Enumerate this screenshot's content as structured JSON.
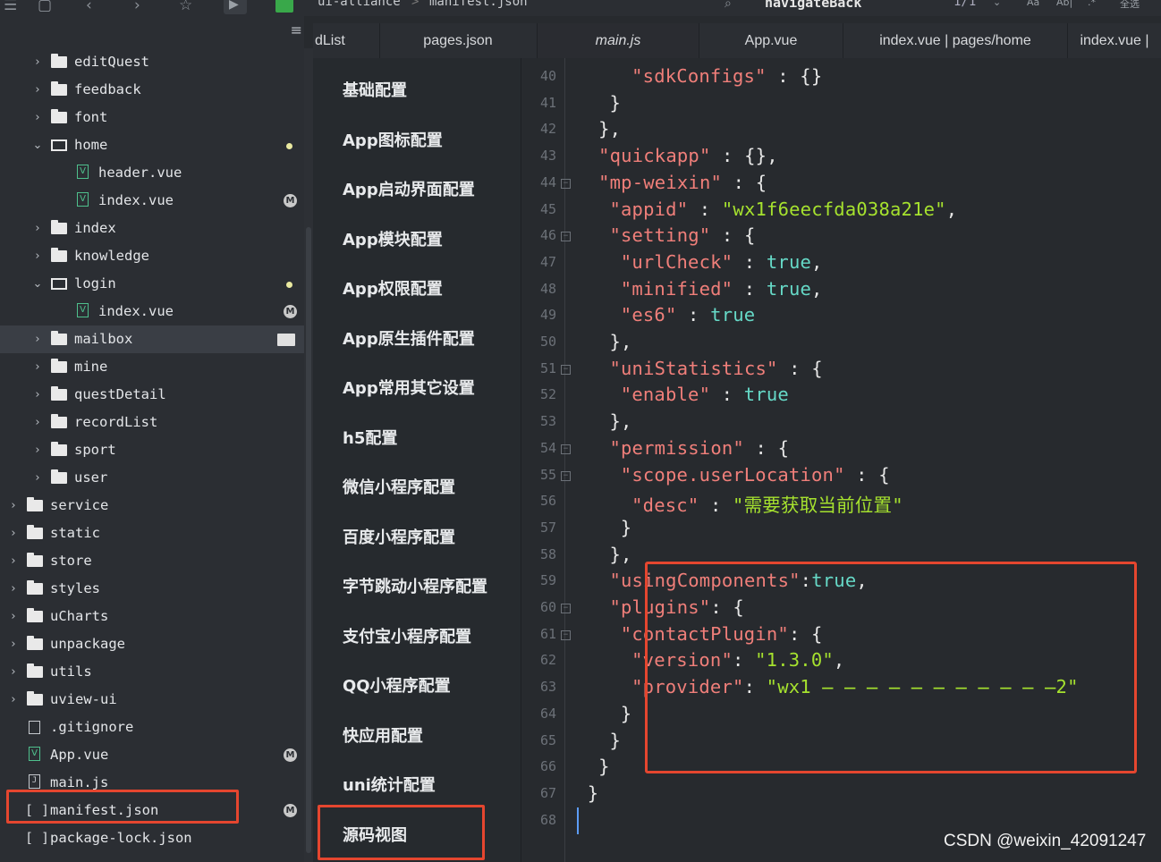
{
  "toolbar": {
    "breadcrumb_project": "ui-alliance",
    "breadcrumb_sep": ">",
    "breadcrumb_file": "manifest.json",
    "search_text": "navigateBack",
    "match_count": "1/1",
    "opt_case": "Aa",
    "opt_word": "Ab|",
    "opt_regex": ".*",
    "opt_select_all": "全选"
  },
  "sidebar": {
    "items": [
      {
        "label": "editQuest"
      },
      {
        "label": "feedback"
      },
      {
        "label": "font"
      },
      {
        "label": "home"
      },
      {
        "label": "header.vue"
      },
      {
        "label": "index.vue",
        "badge": "M"
      },
      {
        "label": "index"
      },
      {
        "label": "knowledge"
      },
      {
        "label": "login"
      },
      {
        "label": "index.vue",
        "badge": "M"
      },
      {
        "label": "mailbox"
      },
      {
        "label": "mine"
      },
      {
        "label": "questDetail"
      },
      {
        "label": "recordList"
      },
      {
        "label": "sport"
      },
      {
        "label": "user"
      },
      {
        "label": "service"
      },
      {
        "label": "static"
      },
      {
        "label": "store"
      },
      {
        "label": "styles"
      },
      {
        "label": "uCharts"
      },
      {
        "label": "unpackage"
      },
      {
        "label": "utils"
      },
      {
        "label": "uview-ui"
      },
      {
        "label": ".gitignore"
      },
      {
        "label": "App.vue",
        "badge": "M"
      },
      {
        "label": "main.js"
      },
      {
        "label": "manifest.json",
        "badge": "M"
      },
      {
        "label": "package-lock.json"
      }
    ]
  },
  "tabs": [
    {
      "label": "dList"
    },
    {
      "label": "pages.json"
    },
    {
      "label": "main.js"
    },
    {
      "label": "App.vue"
    },
    {
      "label": "index.vue | pages/home"
    },
    {
      "label": "index.vue |"
    }
  ],
  "categories": [
    {
      "label": "基础配置"
    },
    {
      "label": "App图标配置"
    },
    {
      "label": "App启动界面配置"
    },
    {
      "label": "App模块配置"
    },
    {
      "label": "App权限配置"
    },
    {
      "label": "App原生插件配置"
    },
    {
      "label": "App常用其它设置"
    },
    {
      "label": "h5配置"
    },
    {
      "label": "微信小程序配置"
    },
    {
      "label": "百度小程序配置"
    },
    {
      "label": "字节跳动小程序配置"
    },
    {
      "label": "支付宝小程序配置"
    },
    {
      "label": "QQ小程序配置"
    },
    {
      "label": "快应用配置"
    },
    {
      "label": "uni统计配置"
    },
    {
      "label": "源码视图"
    }
  ],
  "editor": {
    "lines": [
      {
        "num": "40",
        "t": [
          [
            "k",
            "\"sdkConfigs\""
          ],
          [
            "p",
            " : {}"
          ]
        ]
      },
      {
        "num": "41",
        "t": [
          [
            "p",
            "}"
          ]
        ]
      },
      {
        "num": "42",
        "t": [
          [
            "p",
            "},"
          ]
        ]
      },
      {
        "num": "43",
        "t": [
          [
            "k",
            "\"quickapp\""
          ],
          [
            "p",
            " : {},"
          ]
        ]
      },
      {
        "num": "44",
        "t": [
          [
            "k",
            "\"mp-weixin\""
          ],
          [
            "p",
            " : {"
          ]
        ]
      },
      {
        "num": "45",
        "t": [
          [
            "k",
            "\"appid\""
          ],
          [
            "p",
            " : "
          ],
          [
            "s",
            "\"wx1f6eecfda038a21e\""
          ],
          [
            "p",
            ","
          ]
        ]
      },
      {
        "num": "46",
        "t": [
          [
            "k",
            "\"setting\""
          ],
          [
            "p",
            " : {"
          ]
        ]
      },
      {
        "num": "47",
        "t": [
          [
            "k",
            "\"urlCheck\""
          ],
          [
            "p",
            " : "
          ],
          [
            "b",
            "true"
          ],
          [
            "p",
            ","
          ]
        ]
      },
      {
        "num": "48",
        "t": [
          [
            "k",
            "\"minified\""
          ],
          [
            "p",
            " : "
          ],
          [
            "b",
            "true"
          ],
          [
            "p",
            ","
          ]
        ]
      },
      {
        "num": "49",
        "t": [
          [
            "k",
            "\"es6\""
          ],
          [
            "p",
            " : "
          ],
          [
            "b",
            "true"
          ]
        ]
      },
      {
        "num": "50",
        "t": [
          [
            "p",
            "},"
          ]
        ]
      },
      {
        "num": "51",
        "t": [
          [
            "k",
            "\"uniStatistics\""
          ],
          [
            "p",
            " : {"
          ]
        ]
      },
      {
        "num": "52",
        "t": [
          [
            "k",
            "\"enable\""
          ],
          [
            "p",
            " : "
          ],
          [
            "b",
            "true"
          ]
        ]
      },
      {
        "num": "53",
        "t": [
          [
            "p",
            "},"
          ]
        ]
      },
      {
        "num": "54",
        "t": [
          [
            "k",
            "\"permission\""
          ],
          [
            "p",
            " : {"
          ]
        ]
      },
      {
        "num": "55",
        "t": [
          [
            "k",
            "\"scope.userLocation\""
          ],
          [
            "p",
            " : {"
          ]
        ]
      },
      {
        "num": "56",
        "t": [
          [
            "k",
            "\"desc\""
          ],
          [
            "p",
            " : "
          ],
          [
            "s",
            "\"需要获取当前位置\""
          ]
        ]
      },
      {
        "num": "57",
        "t": [
          [
            "p",
            "}"
          ]
        ]
      },
      {
        "num": "58",
        "t": [
          [
            "p",
            "},"
          ]
        ]
      },
      {
        "num": "59",
        "t": [
          [
            "k",
            "\"usingComponents\""
          ],
          [
            "p",
            ":"
          ],
          [
            "b",
            "true"
          ],
          [
            "p",
            ","
          ]
        ]
      },
      {
        "num": "60",
        "t": [
          [
            "k",
            "\"plugins\""
          ],
          [
            "p",
            ": {"
          ]
        ]
      },
      {
        "num": "61",
        "t": [
          [
            "k",
            "\"contactPlugin\""
          ],
          [
            "p",
            ": {"
          ]
        ]
      },
      {
        "num": "62",
        "t": [
          [
            "k",
            "\"version\""
          ],
          [
            "p",
            ": "
          ],
          [
            "s",
            "\"1.3.0\""
          ],
          [
            "p",
            ","
          ]
        ]
      },
      {
        "num": "63",
        "t": [
          [
            "k",
            "\"provider\""
          ],
          [
            "p",
            ": "
          ],
          [
            "s",
            "\"wx1 ̶ ̶ ̶ ̶ ̶ ̶ ̶ ̶ ̶ ̶ ̶2\""
          ]
        ]
      },
      {
        "num": "64",
        "t": [
          [
            "p",
            "}"
          ]
        ]
      },
      {
        "num": "65",
        "t": [
          [
            "p",
            "}"
          ]
        ]
      },
      {
        "num": "66",
        "t": [
          [
            "p",
            "}"
          ]
        ]
      },
      {
        "num": "67",
        "t": [
          [
            "p",
            "}"
          ]
        ]
      },
      {
        "num": "68",
        "t": []
      }
    ]
  },
  "watermark": "CSDN @weixin_42091247",
  "colors": {
    "highlight": "#e5462f",
    "key": "#f07f7a",
    "string": "#a6e22e",
    "bool": "#66d9c7"
  }
}
